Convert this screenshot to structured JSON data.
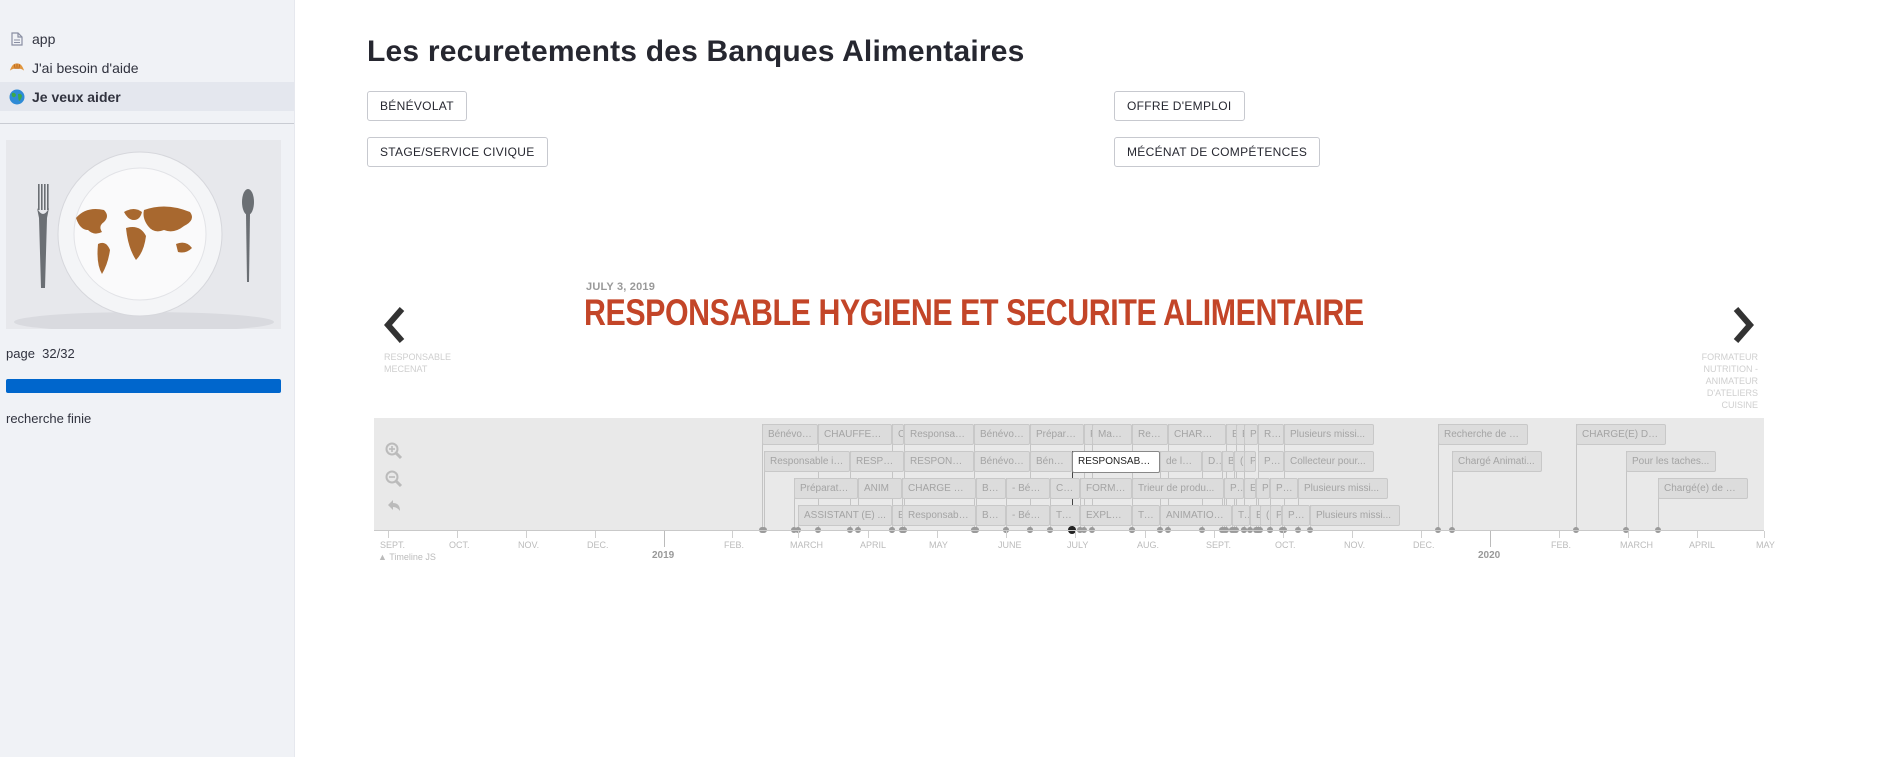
{
  "sidebar": {
    "nav": [
      {
        "label": "app",
        "icon": "document-icon"
      },
      {
        "label": "J'ai besoin d'aide",
        "icon": "croissant-icon"
      },
      {
        "label": "Je veux aider",
        "icon": "globe-icon",
        "active": true
      }
    ],
    "page_label": "page  32/32",
    "progress": 1.0,
    "status": "recherche finie"
  },
  "main": {
    "title": "Les recuretements des Banques Alimentaires",
    "buttons": [
      "BÉNÉVOLAT",
      "OFFRE D'EMPLOI",
      "STAGE/SERVICE CIVIQUE",
      "MÉCÉNAT DE COMPÉTENCES"
    ]
  },
  "timeline": {
    "date": "JULY 3, 2019",
    "headline": "RESPONSABLE HYGIENE ET SECURITE ALIMENTAIRE",
    "prev_label": [
      "RESPONSABLE",
      "MECENAT"
    ],
    "next_label": [
      "FORMATEUR",
      "NUTRITION -",
      "ANIMATEUR",
      "D'ATELIERS",
      "CUISINE"
    ],
    "months": [
      "SEPT.",
      "OCT.",
      "NOV.",
      "DEC.",
      "FEB.",
      "MARCH",
      "APRIL",
      "MAY",
      "JUNE",
      "JULY",
      "AUG.",
      "SEPT.",
      "OCT.",
      "NOV.",
      "DEC.",
      "FEB.",
      "MARCH",
      "APRIL",
      "MAY"
    ],
    "years": [
      "2019",
      "2020"
    ],
    "credit": "Timeline JS",
    "cards": [
      {
        "label": "Bénévole..."
      },
      {
        "label": "CHAUFFEUR B..."
      },
      {
        "label": "C"
      },
      {
        "label": "Responsable"
      },
      {
        "label": "Bénévole/a"
      },
      {
        "label": "Préparate"
      },
      {
        "label": "F"
      },
      {
        "label": "Magasi"
      },
      {
        "label": "Respon"
      },
      {
        "label": "CHARGE(E)"
      },
      {
        "label": "E"
      },
      {
        "label": "E"
      },
      {
        "label": "P"
      },
      {
        "label": "Rect"
      },
      {
        "label": "Plusieurs missi..."
      },
      {
        "label": "Recherche de b..."
      },
      {
        "label": "CHARGE(E) DE ..."
      },
      {
        "label": "Responsable in..."
      },
      {
        "label": "RESPONS"
      },
      {
        "label": "RESPONSABL"
      },
      {
        "label": "Bénévole/ p"
      },
      {
        "label": "Bénévo"
      },
      {
        "label": "RESPONSABLE...",
        "active": true
      },
      {
        "label": "de la c..."
      },
      {
        "label": "De"
      },
      {
        "label": "B"
      },
      {
        "label": "("
      },
      {
        "label": "P"
      },
      {
        "label": "Plus"
      },
      {
        "label": "Collecteur pour..."
      },
      {
        "label": "Chargé Animati..."
      },
      {
        "label": "Pour les taches..."
      },
      {
        "label": "Préparateur"
      },
      {
        "label": "ANIM"
      },
      {
        "label": "CHARGE DE CO"
      },
      {
        "label": "Béné"
      },
      {
        "label": "- Bénévo"
      },
      {
        "label": "Chauf"
      },
      {
        "label": "FORMATE"
      },
      {
        "label": "Trieur de produ..."
      },
      {
        "label": "Pré"
      },
      {
        "label": "E"
      },
      {
        "label": "P"
      },
      {
        "label": "Plus"
      },
      {
        "label": "Plusieurs missi..."
      },
      {
        "label": "Chargé(e) de m..."
      },
      {
        "label": "ASSISTANT (E) ..."
      },
      {
        "label": "E"
      },
      {
        "label": "Responsable I"
      },
      {
        "label": "Béné"
      },
      {
        "label": "- Bénévo"
      },
      {
        "label": "Trieu"
      },
      {
        "label": "EXPLOITA"
      },
      {
        "label": "Trie"
      },
      {
        "label": "ANIMATION /"
      },
      {
        "label": "Tré"
      },
      {
        "label": "E"
      },
      {
        "label": "("
      },
      {
        "label": "P"
      },
      {
        "label": "Plus"
      },
      {
        "label": "Plusieurs missi..."
      }
    ]
  }
}
